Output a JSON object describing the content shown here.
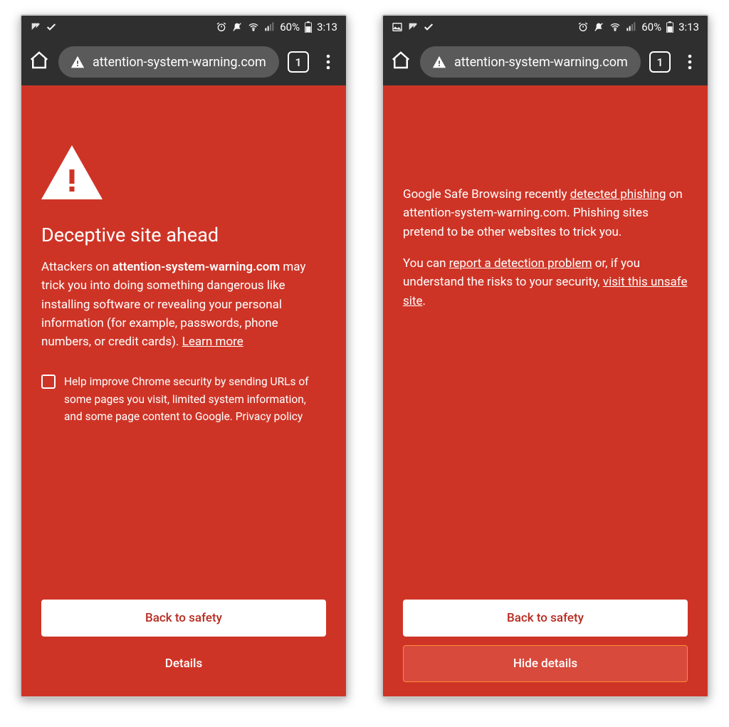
{
  "status": {
    "battery": "60%",
    "time": "3:13"
  },
  "toolbar": {
    "url": "attention-system-warning.com",
    "tab_count": "1"
  },
  "screen1": {
    "heading": "Deceptive site ahead",
    "body_pre": "Attackers on ",
    "body_domain": "attention-system-warning.com",
    "body_post": " may trick you into doing something dangerous like installing software or revealing your personal information (for example, passwords, phone numbers, or credit cards). ",
    "learn_more": "Learn more",
    "checkbox_pre": "Help improve Chrome security by sending ",
    "checkbox_link": "URLs of some pages you visit, limited system information, and some page content",
    "checkbox_post": " to Google. ",
    "privacy": "Privacy policy",
    "back_button": "Back to safety",
    "details_button": "Details"
  },
  "screen2": {
    "p1_pre": "Google Safe Browsing recently ",
    "p1_link": "detected phishing",
    "p1_post": " on attention-system-warning.com. Phishing sites pretend to be other websites to trick you.",
    "p2_pre": "You can ",
    "p2_link1": "report a detection problem",
    "p2_mid": " or, if you understand the risks to your security, ",
    "p2_link2": "visit this unsafe site",
    "p2_post": ".",
    "back_button": "Back to safety",
    "hide_button": "Hide details"
  }
}
